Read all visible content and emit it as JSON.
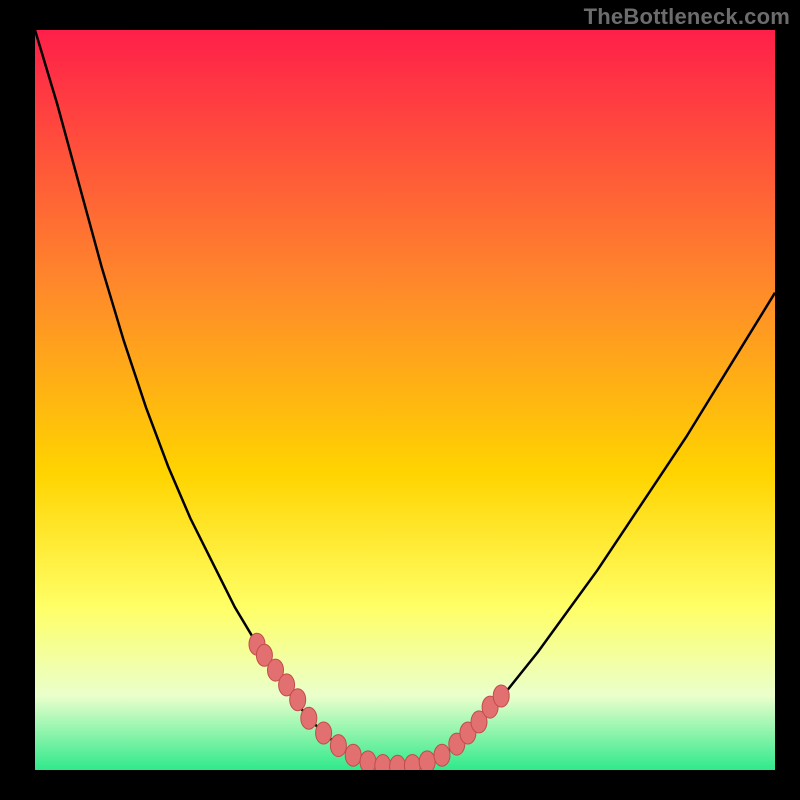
{
  "watermark": "TheBottleneck.com",
  "colors": {
    "black": "#000000",
    "curve": "#000000",
    "dot_fill": "#e27070",
    "dot_stroke": "#c24c4c",
    "grad_top": "#ff1f4a",
    "grad_mid1": "#ff8a2a",
    "grad_mid2": "#ffd400",
    "grad_mid3": "#ffff66",
    "grad_mid4": "#eaffcc",
    "grad_bottom": "#2fe98b"
  },
  "chart_data": {
    "type": "line",
    "title": "",
    "xlabel": "",
    "ylabel": "",
    "xlim": [
      0,
      100
    ],
    "ylim": [
      0,
      100
    ],
    "series": [
      {
        "name": "bottleneck-curve",
        "x": [
          0,
          3,
          6,
          9,
          12,
          15,
          18,
          21,
          24,
          27,
          30,
          33,
          35,
          37,
          39,
          41,
          43,
          45,
          47,
          49,
          51,
          53,
          55,
          57,
          60,
          64,
          68,
          72,
          76,
          80,
          84,
          88,
          92,
          96,
          100
        ],
        "y": [
          100,
          90,
          79,
          68,
          58,
          49,
          41,
          34,
          28,
          22,
          17,
          12.5,
          9.5,
          7,
          5,
          3.3,
          2,
          1.1,
          0.6,
          0.5,
          0.6,
          1.1,
          2,
          3.5,
          6.5,
          11,
          16,
          21.5,
          27,
          33,
          39,
          45,
          51.5,
          58,
          64.5
        ]
      }
    ],
    "dots": {
      "name": "highlight-points",
      "x": [
        30,
        31,
        32.5,
        34,
        35.5,
        37,
        39,
        41,
        43,
        45,
        47,
        49,
        51,
        53,
        55,
        57,
        58.5,
        60,
        61.5,
        63
      ],
      "y": [
        17,
        15.5,
        13.5,
        11.5,
        9.5,
        7,
        5,
        3.3,
        2,
        1.1,
        0.6,
        0.5,
        0.6,
        1.1,
        2,
        3.5,
        5,
        6.5,
        8.5,
        10
      ]
    },
    "gradient_stops": [
      {
        "offset": 0.0,
        "color": "#ff1f4a"
      },
      {
        "offset": 0.35,
        "color": "#ff8a2a"
      },
      {
        "offset": 0.6,
        "color": "#ffd400"
      },
      {
        "offset": 0.78,
        "color": "#ffff66"
      },
      {
        "offset": 0.9,
        "color": "#eaffcc"
      },
      {
        "offset": 1.0,
        "color": "#2fe98b"
      }
    ]
  }
}
